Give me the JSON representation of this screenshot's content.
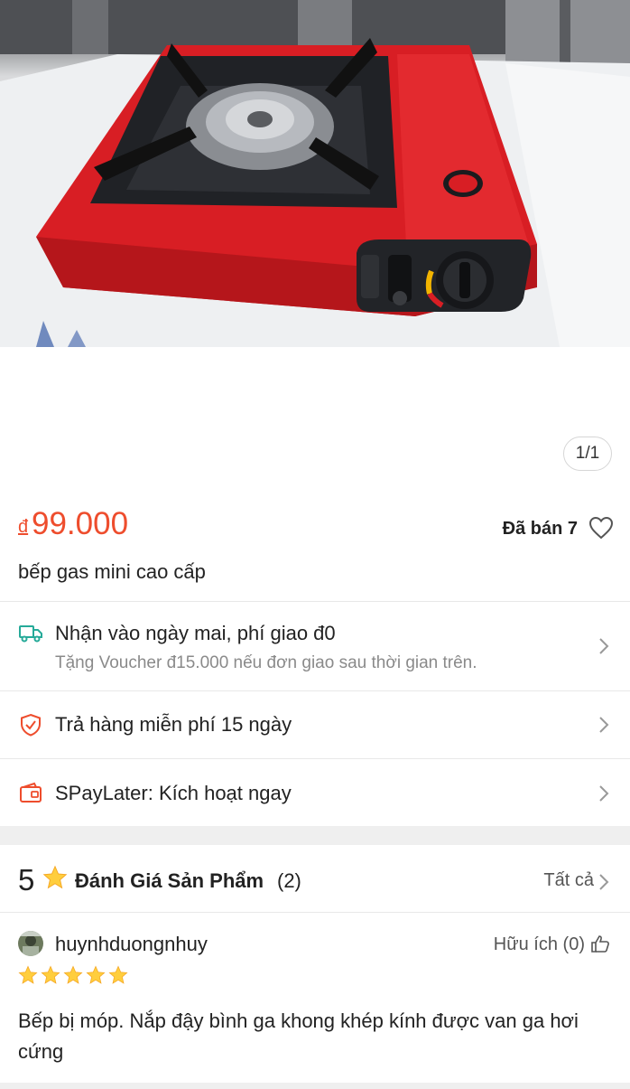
{
  "product": {
    "image_counter": "1/1",
    "currency": "đ",
    "price": "99.000",
    "sold_label": "Đã bán 7",
    "title": "bếp gas mini cao cấp"
  },
  "shipping": {
    "label": "Nhận vào ngày mai, phí giao đ0",
    "sub": "Tặng Voucher đ15.000 nếu đơn giao sau thời gian trên."
  },
  "returns": {
    "label": "Trả hàng miễn phí 15 ngày"
  },
  "paylater": {
    "label": "SPayLater: Kích hoạt ngay"
  },
  "ratings": {
    "score": "5",
    "label": "Đánh Giá Sản Phẩm",
    "count": "(2)",
    "see_all": "Tất cả"
  },
  "review": {
    "username": "huynhduongnhuy",
    "helpful": "Hữu ích (0)",
    "stars": 5,
    "text": "Bếp bị móp. Nắp đậy bình ga khong khép kính được van ga hơi cứng"
  },
  "colors": {
    "accent": "#ee4d2d",
    "shipping_icon": "#26aa99",
    "star": "#ffce3d"
  },
  "icons": [
    "heart-icon",
    "truck-icon",
    "shield-icon",
    "wallet-icon",
    "chevron-right-icon",
    "star-icon",
    "thumbs-up-icon"
  ]
}
